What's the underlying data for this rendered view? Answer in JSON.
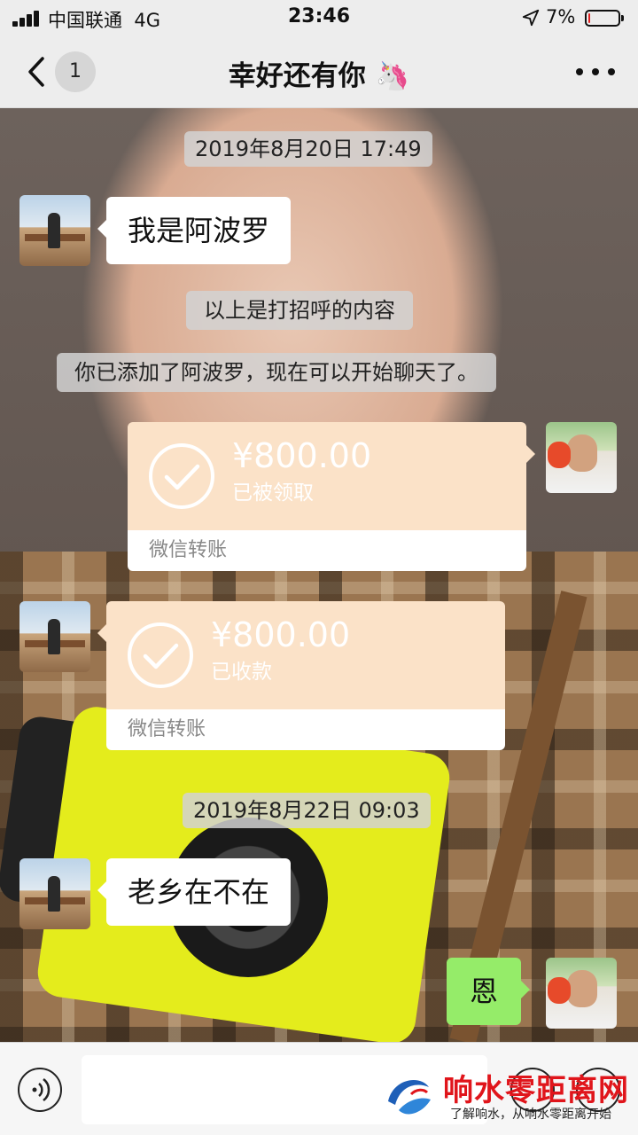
{
  "status_bar": {
    "carrier": "中国联通",
    "network": "4G",
    "time": "23:46",
    "battery_percent": "7%",
    "battery_level": 0.07,
    "signal_bars": 4
  },
  "header": {
    "back_count": "1",
    "title": "幸好还有你 🦄",
    "more_icon": "more-dots-icon"
  },
  "messages": {
    "ts1": "2019年8月20日 17:49",
    "greet": "我是阿波罗",
    "sys1": "以上是打招呼的内容",
    "sys2": "你已添加了阿波罗，现在可以开始聊天了。",
    "transfer1": {
      "amount": "¥800.00",
      "status": "已被领取",
      "label": "微信转账"
    },
    "transfer2": {
      "amount": "¥800.00",
      "status": "已收款",
      "label": "微信转账"
    },
    "ts2": "2019年8月22日 09:03",
    "ask": "老乡在不在",
    "reply": "恩"
  },
  "input_bar": {
    "placeholder": "",
    "voice_icon": "voice-icon",
    "emoji_icon": "emoji-icon",
    "plus_icon": "plus-icon"
  },
  "watermark": {
    "name": "响水零距离网",
    "slogan": "了解响水，从响水零距离开始"
  },
  "colors": {
    "transfer_bg": "#fbe2c8",
    "green_bubble": "#95ec69",
    "battery_low": "#e02020",
    "watermark_red": "#e0151b"
  }
}
